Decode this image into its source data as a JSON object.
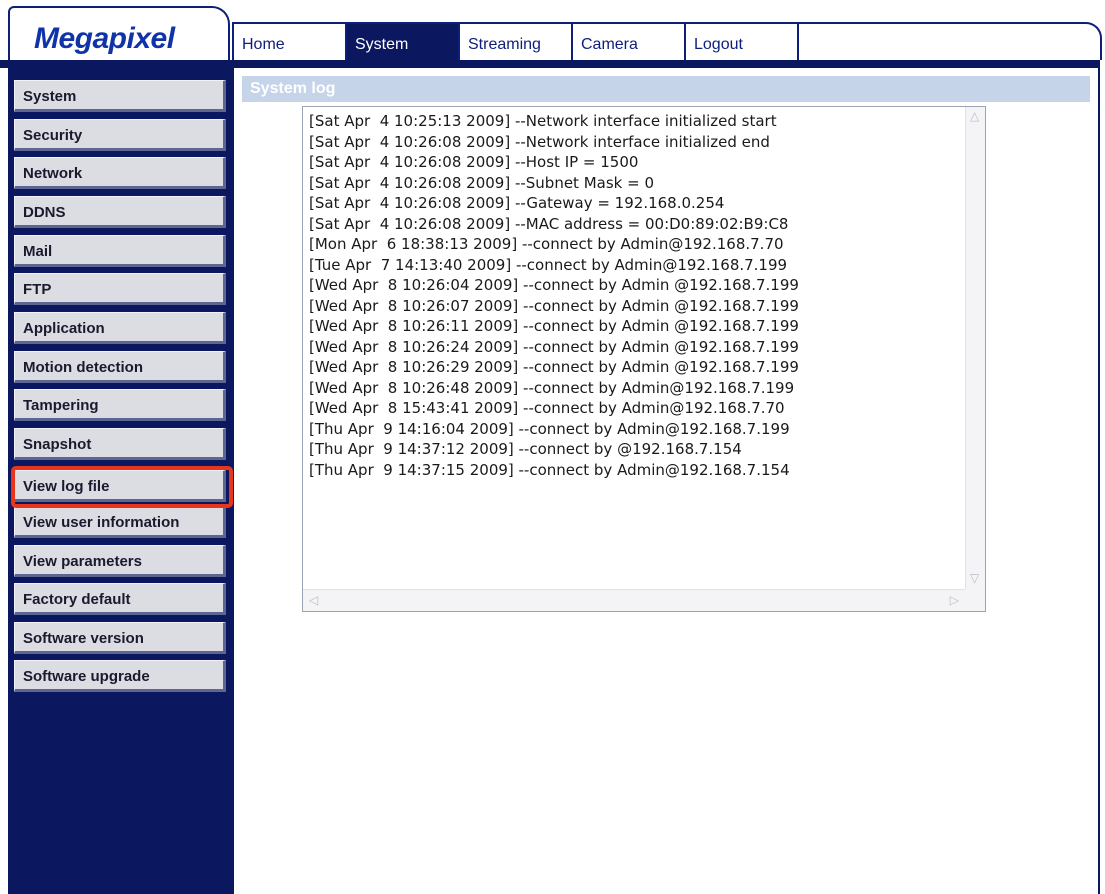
{
  "brand": {
    "logo": "Megapixel"
  },
  "nav": {
    "tabs": [
      {
        "label": "Home"
      },
      {
        "label": "System"
      },
      {
        "label": "Streaming"
      },
      {
        "label": "Camera"
      },
      {
        "label": "Logout"
      }
    ],
    "active": "System"
  },
  "sidebar": {
    "items": [
      {
        "label": "System"
      },
      {
        "label": "Security"
      },
      {
        "label": "Network"
      },
      {
        "label": "DDNS"
      },
      {
        "label": "Mail"
      },
      {
        "label": "FTP"
      },
      {
        "label": "Application"
      },
      {
        "label": "Motion detection"
      },
      {
        "label": "Tampering"
      },
      {
        "label": "Snapshot"
      },
      {
        "label": "View log file"
      },
      {
        "label": "View user information"
      },
      {
        "label": "View parameters"
      },
      {
        "label": "Factory default"
      },
      {
        "label": "Software version"
      },
      {
        "label": "Software upgrade"
      }
    ],
    "highlighted": "View log file",
    "highlight_color": "#e8361c"
  },
  "main": {
    "section_title": "System log",
    "log_lines": [
      "[Sat Apr  4 10:25:13 2009] --Network interface initialized start",
      "[Sat Apr  4 10:26:08 2009] --Network interface initialized end",
      "[Sat Apr  4 10:26:08 2009] --Host IP = 1500",
      "[Sat Apr  4 10:26:08 2009] --Subnet Mask = 0",
      "[Sat Apr  4 10:26:08 2009] --Gateway = 192.168.0.254",
      "[Sat Apr  4 10:26:08 2009] --MAC address = 00:D0:89:02:B9:C8",
      "[Mon Apr  6 18:38:13 2009] --connect by Admin@192.168.7.70",
      "[Tue Apr  7 14:13:40 2009] --connect by Admin@192.168.7.199",
      "[Wed Apr  8 10:26:04 2009] --connect by Admin @192.168.7.199",
      "[Wed Apr  8 10:26:07 2009] --connect by Admin @192.168.7.199",
      "[Wed Apr  8 10:26:11 2009] --connect by Admin @192.168.7.199",
      "[Wed Apr  8 10:26:24 2009] --connect by Admin @192.168.7.199",
      "[Wed Apr  8 10:26:29 2009] --connect by Admin @192.168.7.199",
      "[Wed Apr  8 10:26:48 2009] --connect by Admin@192.168.7.199",
      "[Wed Apr  8 15:43:41 2009] --connect by Admin@192.168.7.70",
      "[Thu Apr  9 14:16:04 2009] --connect by Admin@192.168.7.199",
      "[Thu Apr  9 14:37:12 2009] --connect by @192.168.7.154",
      "[Thu Apr  9 14:37:15 2009] --connect by Admin@192.168.7.154"
    ]
  },
  "colors": {
    "navy": "#0b1860",
    "section_header_bg": "#c6d4ea"
  }
}
